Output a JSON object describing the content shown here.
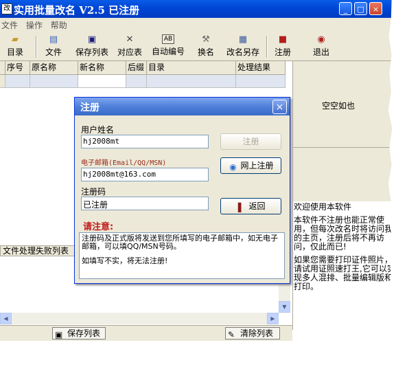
{
  "window": {
    "title": "实用批量改名 V2.5 已注册",
    "controls": {
      "minimize": "_",
      "maximize": "□",
      "close": "×"
    }
  },
  "menu": [
    "文件",
    "操作",
    "帮助"
  ],
  "toolbar": [
    {
      "label": "目录",
      "icon": "folder-icon"
    },
    {
      "label": "文件",
      "icon": "file-icon"
    },
    {
      "label": "保存列表",
      "icon": "save-icon"
    },
    {
      "label": "对应表",
      "icon": "table-icon"
    },
    {
      "label": "自动编号",
      "icon": "numbering-icon"
    },
    {
      "label": "换名",
      "icon": "rename-icon"
    },
    {
      "label": "改名另存",
      "icon": "save-as-icon"
    },
    {
      "label": "注册",
      "icon": "register-icon"
    },
    {
      "label": "退出",
      "icon": "exit-icon"
    }
  ],
  "grid": {
    "columns": [
      "序号",
      "原名称",
      "新名称",
      "后缀",
      "目录",
      "处理结果"
    ]
  },
  "right_pane": {
    "empty_text": "空空如也",
    "welcome": [
      "欢迎使用本软件",
      "本软件不注册也能正常使用，但每次改名时将访问我的主页，注册后将不再访问，仅此而已!",
      "如果您需要打印证件照片，请试用证照速打王,它可以实现多人混排、批量编辑版和打印。"
    ]
  },
  "fail_list_label": "文件处理失败列表",
  "status": {
    "save_list": "保存列表",
    "clear_list": "清除列表"
  },
  "dialog": {
    "title": "注册",
    "close": "×",
    "username_label": "用户姓名",
    "username_value": "hj2008mt",
    "email_label": "电子邮箱(Email/QQ/MSN)",
    "email_value": "hj2008mt@163.com",
    "code_label": "注册码",
    "code_value": "已注册",
    "register_button": "注册",
    "online_register_button": "网上注册",
    "back_button": "返回",
    "notice_header": "请注意:",
    "notice_lines": [
      "注册码及正式版将发送到您所填写的电子邮箱中，如无电子邮箱，可以填QQ/MSN号码。",
      "如填写不实，将无法注册!"
    ]
  }
}
